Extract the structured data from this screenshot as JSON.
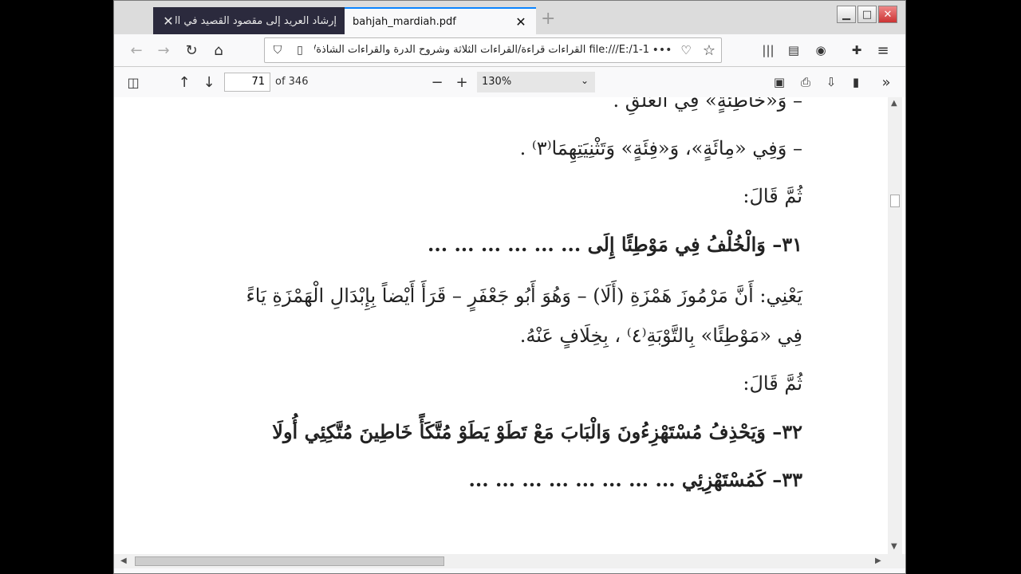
{
  "tabs": [
    {
      "title": "إرشاد العريد إلى مقصود القصيد في القراء",
      "active": false
    },
    {
      "title": "bahjah_mardiah.pdf",
      "active": true
    }
  ],
  "address_bar": {
    "url": "file:///E:/1-1 القراءات قراءة/القراءات الثلاثة وشروح الدرة والقراءات الشاذة/الثلاثة"
  },
  "pdf_toolbar": {
    "page_number": "71",
    "page_count": "of 346",
    "zoom": "130%"
  },
  "document": {
    "lines": [
      "– وَ«خَاطِئَةٍ» فِي العَلَقِ .",
      "– وَفِي «مِائَةٍ»، وَ«فِئَةٍ» وَتَثْنِيَتِهِمَا⁽٣⁾ .",
      "ثُمَّ قَالَ:",
      "٣١– وَالْخُلْفُ فِي مَوْطِئًا إِلَى ...  ...  ...  ...  ...  ...",
      "يَعْنِي: أَنَّ مَرْمُوزَ هَمْزَةِ (أَلَا) – وَهُوَ أَبُو جَعْفَرٍ – قَرَأَ أَيْضاً بِإِبْدَالِ الْهَمْزَةِ يَاءً",
      "فِي «مَوْطِئًا» بِالتَّوْبَةِ⁽٤⁾ ، بِخِلَافٍ عَنْهُ.",
      "ثُمَّ قَالَ:",
      "٣٢– وَيَحْذِفُ مُسْتَهْزِءُونَ وَالْبَابَ مَعْ تَطَوْ       يَطَوْ مُتَّكَأً خَاطِينَ مُتَّكِئِي أُولَا",
      "٣٣– كَمُسْتَهْزِئِي ...  ...  ...  ...  ...  ...  ...  ..."
    ]
  },
  "colors": {
    "accent": "#0a84ff",
    "inactive_tab": "#2b2a3d",
    "titlebar": "#dcdcdc"
  }
}
